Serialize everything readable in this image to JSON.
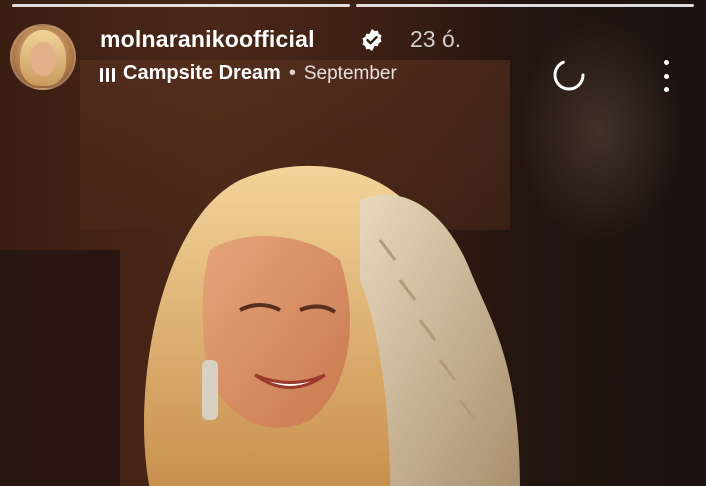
{
  "story": {
    "username": "molnaranikoofficial",
    "time_ago": "23 ó.",
    "music": {
      "song": "Campsite Dream",
      "separator": "•",
      "album": "September"
    },
    "progress_segments": 2,
    "progress_active": 1
  },
  "icons": {
    "verified": "verified-badge-icon",
    "music": "music-bars-icon",
    "loading": "loading-spinner-icon",
    "more": "more-vertical-icon"
  },
  "colors": {
    "text": "#ffffff",
    "muted": "#c8c8c8"
  }
}
